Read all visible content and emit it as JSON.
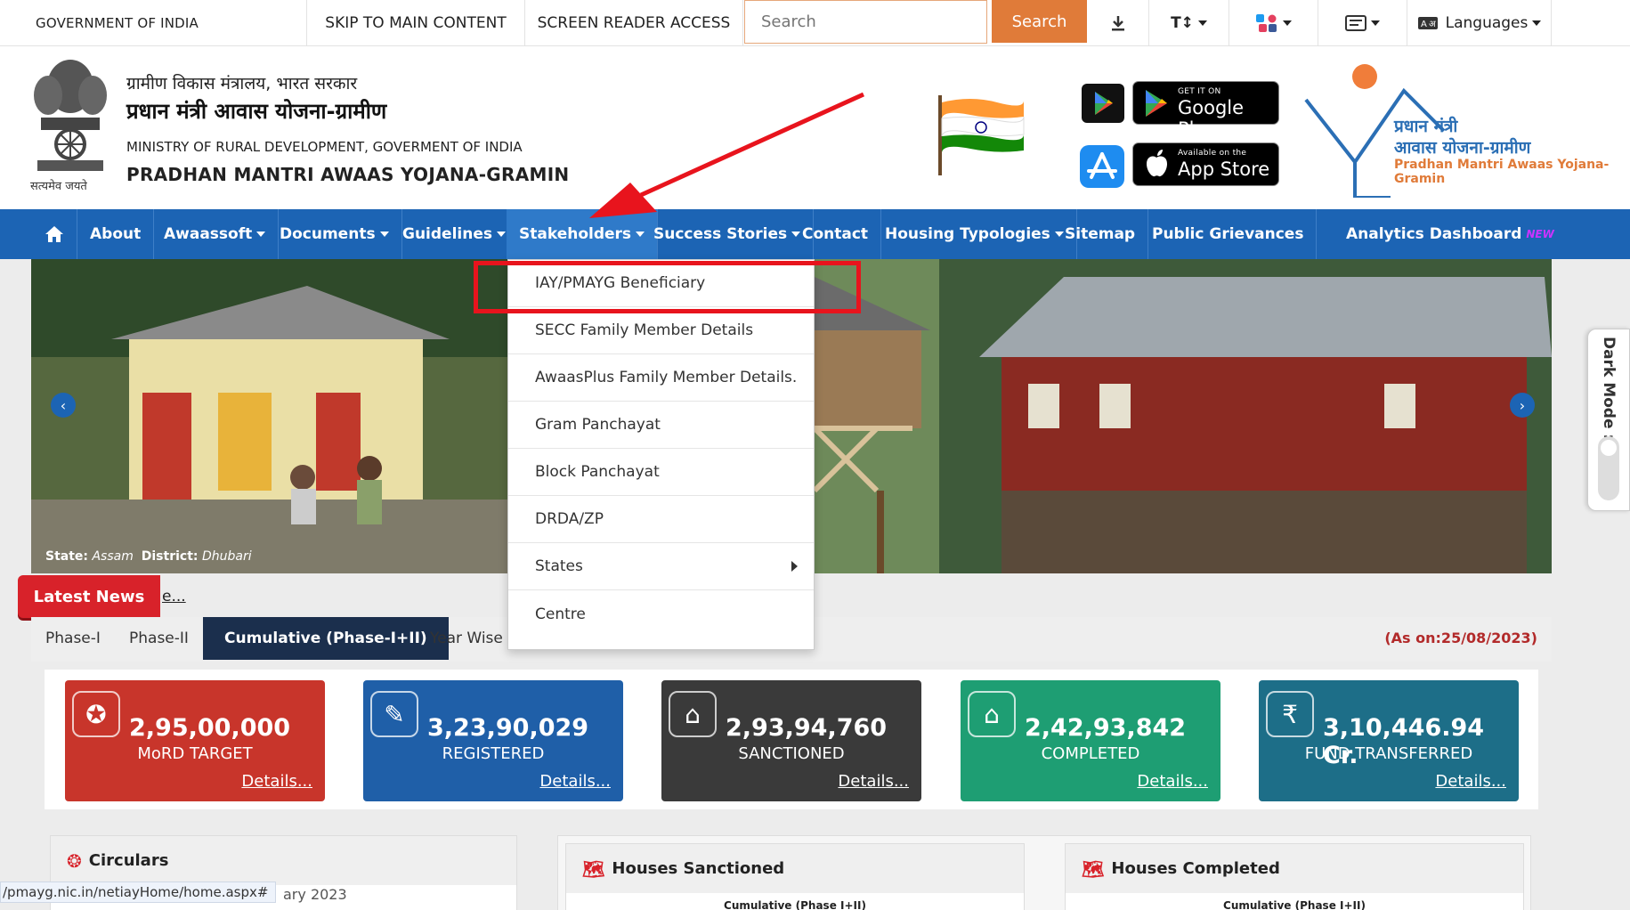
{
  "utility_bar": {
    "gov_label": "GOVERNMENT OF INDIA",
    "skip_label": "SKIP TO MAIN CONTENT",
    "screen_reader_label": "SCREEN READER ACCESS",
    "search_placeholder": "Search",
    "search_button": "Search",
    "text_size_label": "T↕",
    "languages_label": "Languages",
    "icons": [
      "download-icon",
      "text-size-icon",
      "social-icon",
      "display-icon",
      "language-icon"
    ]
  },
  "header": {
    "emblem_caption": "सत्यमेव जयते",
    "hindi_ministry": "ग्रामीण विकास मंत्रालय, भारत सरकार",
    "hindi_scheme": "प्रधान मंत्री आवास योजना-ग्रामीण",
    "english_ministry": "MINISTRY OF RURAL DEVELOPMENT, GOVERMENT OF INDIA",
    "english_scheme": "PRADHAN MANTRI AWAAS YOJANA-GRAMIN",
    "google_play_small": "GET IT ON",
    "google_play_big": "Google Play",
    "app_store_small": "Available on the",
    "app_store_big": "App Store",
    "logo_line1": "प्रधान मंत्री",
    "logo_line2": "आवास योजना-ग्रामीण",
    "logo_line3": "Pradhan Mantri Awaas Yojana-Gramin"
  },
  "nav": {
    "home_icon": "home-icon",
    "items": [
      "About",
      "Awaassoft",
      "Documents",
      "Guidelines",
      "Stakeholders",
      "Success Stories",
      "Contact",
      "Housing Typologies",
      "Sitemap",
      "Public Grievances",
      "Analytics Dashboard"
    ],
    "new_badge": "NEW"
  },
  "dropdown": {
    "items": [
      "IAY/PMAYG Beneficiary",
      "SECC Family Member Details",
      "AwaasPlus Family Member Details.",
      "Gram Panchayat",
      "Block Panchayat",
      "DRDA/ZP",
      "States",
      "Centre"
    ]
  },
  "banner": {
    "state_label": "State:",
    "state_value": "Assam",
    "district_label": "District:",
    "district_value": "Dhubari"
  },
  "news": {
    "label": "Latest News",
    "more": "e..."
  },
  "tabs": {
    "items": [
      "Phase-I",
      "Phase-II",
      "Cumulative (Phase-I+II)",
      "Year Wise"
    ],
    "active": "Cumulative (Phase-I+II)",
    "as_on": "(As on:25/08/2023)"
  },
  "stats": [
    {
      "value": "2,95,00,000",
      "label": "MoRD TARGET",
      "details": "Details...",
      "color": "#c8352b",
      "icon": "users-target-icon"
    },
    {
      "value": "3,23,90,029",
      "label": "REGISTERED",
      "details": "Details...",
      "color": "#1f5fa8",
      "icon": "register-form-icon"
    },
    {
      "value": "2,93,94,760",
      "label": "SANCTIONED",
      "details": "Details...",
      "color": "#3a3a3a",
      "icon": "house-icon"
    },
    {
      "value": "2,42,93,842",
      "label": "COMPLETED",
      "details": "Details...",
      "color": "#1e9e73",
      "icon": "houses-completed-icon"
    },
    {
      "value": "3,10,446.94 Cr.",
      "label": "FUND TRANSFERRED",
      "details": "Details...",
      "color": "#1d6e88",
      "icon": "fund-transfer-icon"
    }
  ],
  "panels": {
    "circulars_title": "Circulars",
    "circulars_snippet": "ary 2023",
    "sanctioned_title": "Houses Sanctioned",
    "sanctioned_sub": "Cumulative (Phase I+II)",
    "completed_title": "Houses Completed",
    "completed_sub": "Cumulative (Phase I+II)"
  },
  "dark_mode": {
    "label": "Dark Mode :"
  },
  "status_url": "/pmayg.nic.in/netiayHome/home.aspx#",
  "colors": {
    "nav_blue": "#1c64b4",
    "search_orange": "#e07b39",
    "highlight_red": "#e8141d",
    "active_tab": "#1b2f4d"
  }
}
